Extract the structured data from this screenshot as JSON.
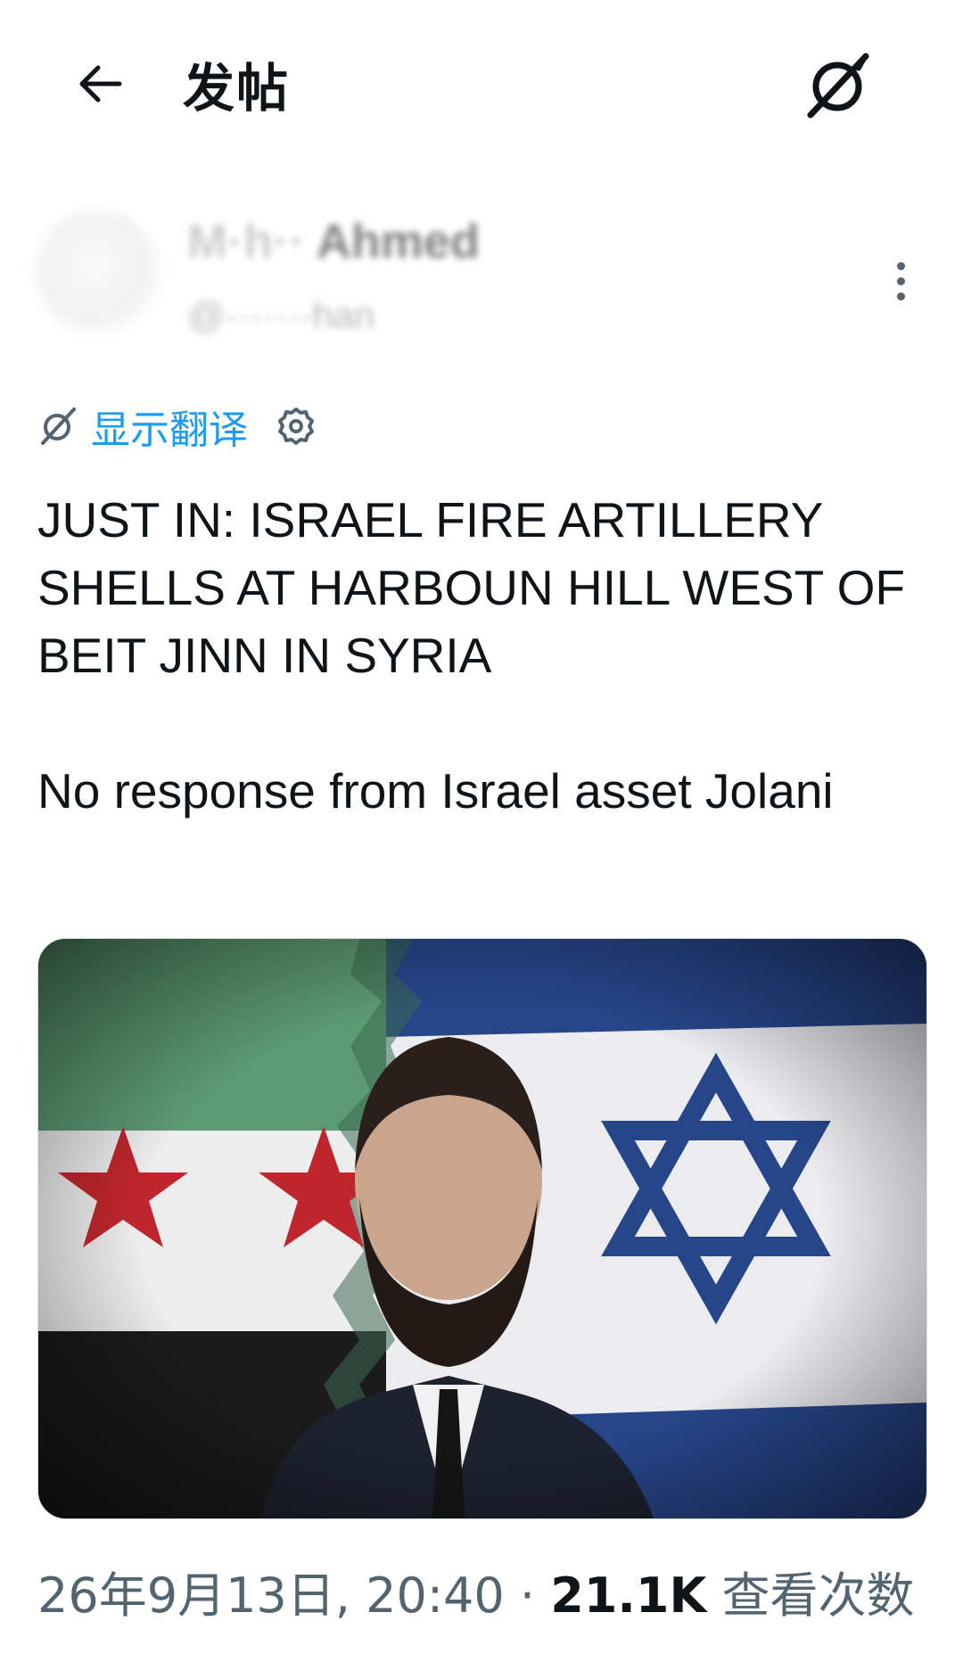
{
  "header": {
    "title": "发帖",
    "back_icon": "back-arrow-icon",
    "grok_icon": "grok-icon"
  },
  "author": {
    "display_name": "Ahmed",
    "handle": "han",
    "more_icon": "more-vertical-icon"
  },
  "translate": {
    "label": "显示翻译",
    "icon": "grok-icon",
    "settings_icon": "gear-icon",
    "accent_color": "#1d9bf0"
  },
  "post": {
    "paragraphs": [
      "JUST IN: ISRAEL FIRE ARTILLERY SHELLS AT HARBOUN HILL WEST OF BEIT JINN IN SYRIA",
      "No response from Israel asset Jolani"
    ]
  },
  "media": {
    "description_icon": "photo-image"
  },
  "meta": {
    "timestamp": "26年9月13日, 20:40",
    "separator": "·",
    "views_count": "21.1K",
    "views_label": "查看次数"
  }
}
